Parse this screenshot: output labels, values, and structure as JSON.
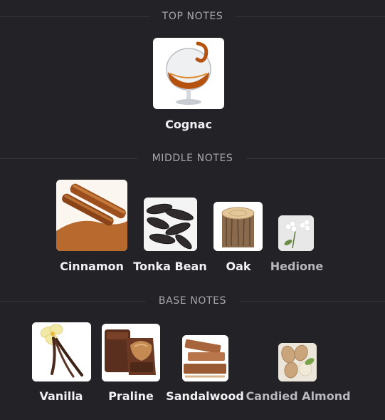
{
  "sections": {
    "top": {
      "title": "TOP NOTES",
      "notes": [
        {
          "name": "Cognac",
          "icon": "cognac-glass-image"
        }
      ]
    },
    "middle": {
      "title": "MIDDLE NOTES",
      "notes": [
        {
          "name": "Cinnamon",
          "icon": "cinnamon-sticks-image"
        },
        {
          "name": "Tonka Bean",
          "icon": "tonka-beans-image"
        },
        {
          "name": "Oak",
          "icon": "oak-log-image"
        },
        {
          "name": "Hedione",
          "icon": "jasmine-flower-image"
        }
      ]
    },
    "base": {
      "title": "BASE NOTES",
      "notes": [
        {
          "name": "Vanilla",
          "icon": "vanilla-flower-image"
        },
        {
          "name": "Praline",
          "icon": "praline-chocolate-image"
        },
        {
          "name": "Sandalwood",
          "icon": "sandalwood-sticks-image"
        },
        {
          "name": "Candied Almond",
          "icon": "almonds-image"
        }
      ]
    }
  },
  "colors": {
    "background": "#232226",
    "divider": "#35343a",
    "heading": "#a9a8ae",
    "label": "#f2f2f4",
    "label_dim": "#b9b8be"
  }
}
